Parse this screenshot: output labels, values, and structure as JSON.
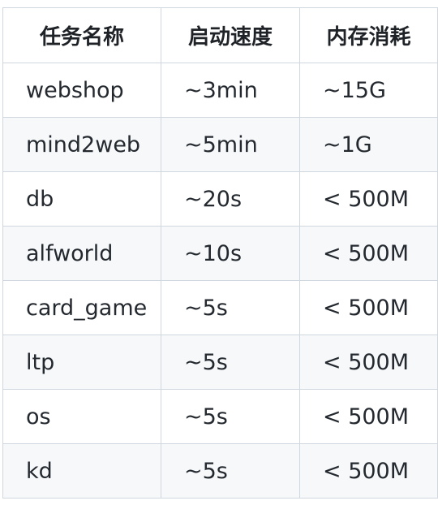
{
  "table": {
    "headers": [
      "任务名称",
      "启动速度",
      "内存消耗"
    ],
    "rows": [
      [
        "webshop",
        "~3min",
        "~15G"
      ],
      [
        "mind2web",
        "~5min",
        "~1G"
      ],
      [
        "db",
        "~20s",
        "< 500M"
      ],
      [
        "alfworld",
        "~10s",
        "< 500M"
      ],
      [
        "card_game",
        "~5s",
        "< 500M"
      ],
      [
        "ltp",
        "~5s",
        "< 500M"
      ],
      [
        "os",
        "~5s",
        "< 500M"
      ],
      [
        "kd",
        "~5s",
        "< 500M"
      ]
    ]
  },
  "colors": {
    "border": "#d0d7de",
    "stripe": "#f6f8fa",
    "text": "#1f2328"
  }
}
